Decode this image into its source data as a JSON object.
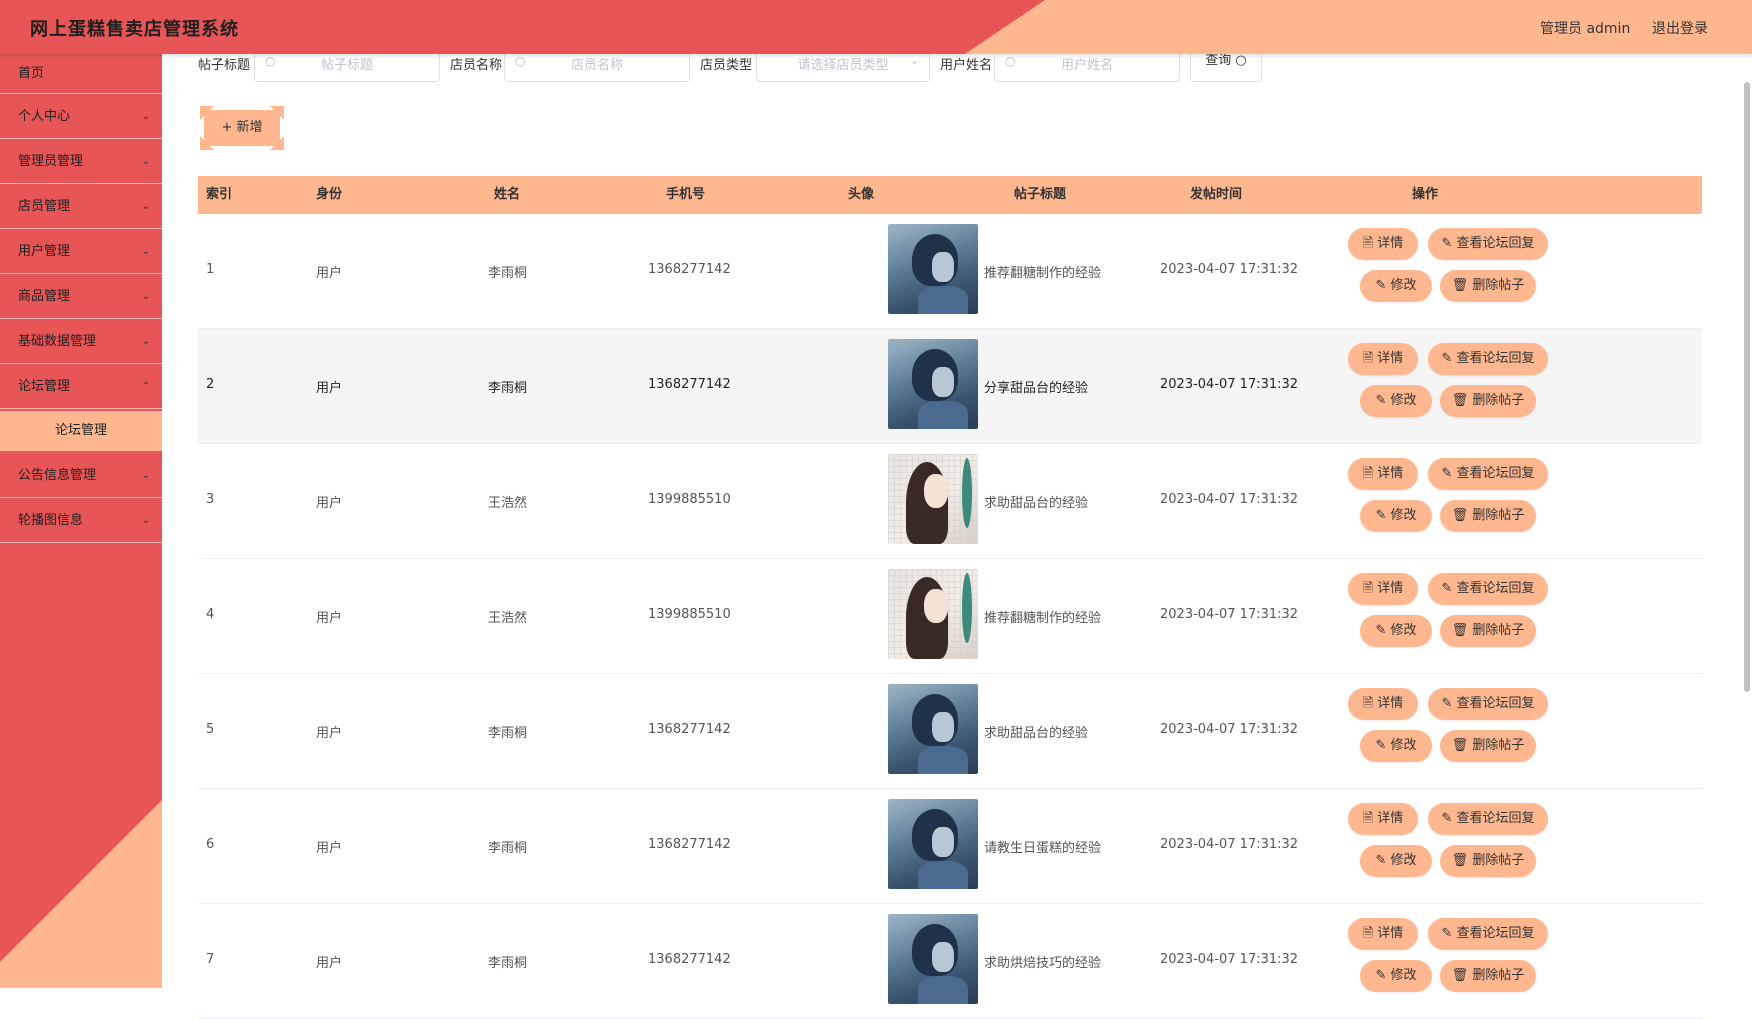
{
  "header": {
    "title": "网上蛋糕售卖店管理系统",
    "admin_label": "管理员 admin",
    "logout": "退出登录"
  },
  "sidebar": {
    "items": [
      {
        "label": "首页",
        "chevron": ""
      },
      {
        "label": "个人中心",
        "chevron": "⌄"
      },
      {
        "label": "管理员管理",
        "chevron": "⌄"
      },
      {
        "label": "店员管理",
        "chevron": "⌄"
      },
      {
        "label": "用户管理",
        "chevron": "⌄"
      },
      {
        "label": "商品管理",
        "chevron": "⌄"
      },
      {
        "label": "基础数据管理",
        "chevron": "⌄"
      },
      {
        "label": "论坛管理",
        "chevron": "⌃"
      }
    ],
    "sub_item": "论坛管理",
    "items_after": [
      {
        "label": "公告信息管理",
        "chevron": "⌄"
      },
      {
        "label": "轮播图信息",
        "chevron": "⌄"
      }
    ]
  },
  "search": {
    "title_label": "帖子标题",
    "title_placeholder": "帖子标题",
    "staff_label": "店员名称",
    "staff_placeholder": "店员名称",
    "type_label": "店员类型",
    "type_placeholder": "请选择店员类型",
    "user_label": "用户姓名",
    "user_placeholder": "用户姓名",
    "query_button": "查询"
  },
  "add_button": "+ 新增",
  "table": {
    "headers": [
      "索引",
      "身份",
      "姓名",
      "手机号",
      "头像",
      "帖子标题",
      "发帖时间",
      "操作"
    ],
    "rows": [
      {
        "index": "1",
        "role": "用户",
        "name": "李雨桐",
        "phone": "1368277142",
        "avatar": "boy",
        "title": "推荐翻糖制作的经验",
        "time": "2023-04-07 17:31:32"
      },
      {
        "index": "2",
        "role": "用户",
        "name": "李雨桐",
        "phone": "1368277142",
        "avatar": "boy",
        "title": "分享甜品台的经验",
        "time": "2023-04-07 17:31:32"
      },
      {
        "index": "3",
        "role": "用户",
        "name": "王浩然",
        "phone": "1399885510",
        "avatar": "girl",
        "title": "求助甜品台的经验",
        "time": "2023-04-07 17:31:32"
      },
      {
        "index": "4",
        "role": "用户",
        "name": "王浩然",
        "phone": "1399885510",
        "avatar": "girl",
        "title": "推荐翻糖制作的经验",
        "time": "2023-04-07 17:31:32"
      },
      {
        "index": "5",
        "role": "用户",
        "name": "李雨桐",
        "phone": "1368277142",
        "avatar": "boy",
        "title": "求助甜品台的经验",
        "time": "2023-04-07 17:31:32"
      },
      {
        "index": "6",
        "role": "用户",
        "name": "李雨桐",
        "phone": "1368277142",
        "avatar": "boy",
        "title": "请教生日蛋糕的经验",
        "time": "2023-04-07 17:31:32"
      },
      {
        "index": "7",
        "role": "用户",
        "name": "李雨桐",
        "phone": "1368277142",
        "avatar": "boy",
        "title": "求助烘焙技巧的经验",
        "time": "2023-04-07 17:31:32"
      }
    ],
    "actions": {
      "detail": "详情",
      "view_reply": "查看论坛回复",
      "edit": "修改",
      "delete": "删除帖子"
    }
  },
  "colors": {
    "primary_red": "#e85556",
    "accent_peach": "#ffb78f"
  }
}
